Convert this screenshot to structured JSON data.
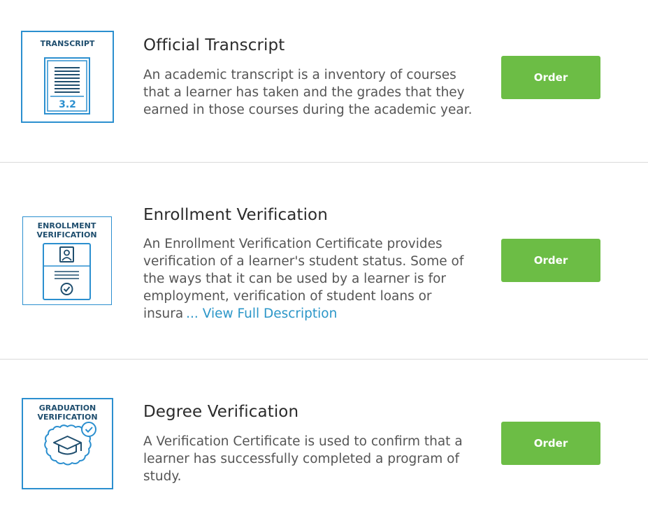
{
  "products": [
    {
      "title": "Official Transcript",
      "description": "An academic transcript is a inventory of courses that a learner has taken and the grades that they earned in those courses during the academic year.",
      "order_label": "Order",
      "icon": {
        "name": "transcript-icon",
        "label": "TRANSCRIPT",
        "grade": "3.2"
      }
    },
    {
      "title": "Enrollment Verification",
      "description": "An Enrollment Verification Certificate provides verification of a learner's student status. Some of the ways that it can be used by a learner is for employment, verification of student loans or insura",
      "more_link": "... View Full Description",
      "order_label": "Order",
      "icon": {
        "name": "enrollment-verification-icon",
        "label_line1": "ENROLLMENT",
        "label_line2": "VERIFICATION"
      }
    },
    {
      "title": "Degree Verification",
      "description": "A Verification Certificate is used to confirm that a learner has successfully completed a program of study.",
      "order_label": "Order",
      "icon": {
        "name": "graduation-verification-icon",
        "label_line1": "GRADUATION",
        "label_line2": "VERIFICATION"
      }
    }
  ],
  "colors": {
    "accent_blue": "#2b8fcf",
    "icon_text_navy": "#1f4e6e",
    "button_green": "#6cbd45",
    "link_blue": "#2b96c8",
    "divider": "#d9d9d9"
  }
}
